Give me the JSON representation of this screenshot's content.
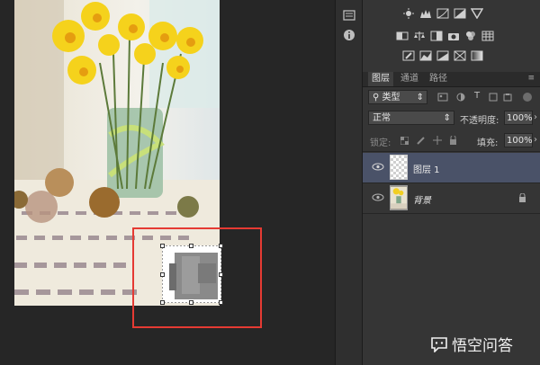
{
  "tabs": {
    "items": [
      {
        "label": "图层",
        "active": true
      },
      {
        "label": "通道",
        "active": false
      },
      {
        "label": "路径",
        "active": false
      }
    ]
  },
  "filter": {
    "kind_label": "类型"
  },
  "blend": {
    "mode": "正常",
    "opacity_label": "不透明度:",
    "opacity_value": "100%"
  },
  "lock": {
    "label": "锁定:",
    "fill_label": "填充:",
    "fill_value": "100%"
  },
  "layers": [
    {
      "name": "图层 1",
      "selected": true
    },
    {
      "name": "背景",
      "selected": false,
      "locked": true
    }
  ],
  "watermark": {
    "text": "悟空问答"
  },
  "colors": {
    "selection": "#e53a33",
    "panel_bg": "#353535",
    "layer_selected": "#4a5268"
  },
  "icons": [
    "brightness-icon",
    "levels-icon",
    "curves-icon",
    "exposure-icon",
    "vibrance-icon",
    "hue-saturation-icon",
    "color-balance-icon",
    "black-white-icon",
    "photo-filter-icon",
    "channel-mixer-icon",
    "color-lookup-icon",
    "invert-icon",
    "posterize-icon",
    "threshold-icon",
    "selective-color-icon",
    "gradient-map-icon"
  ]
}
